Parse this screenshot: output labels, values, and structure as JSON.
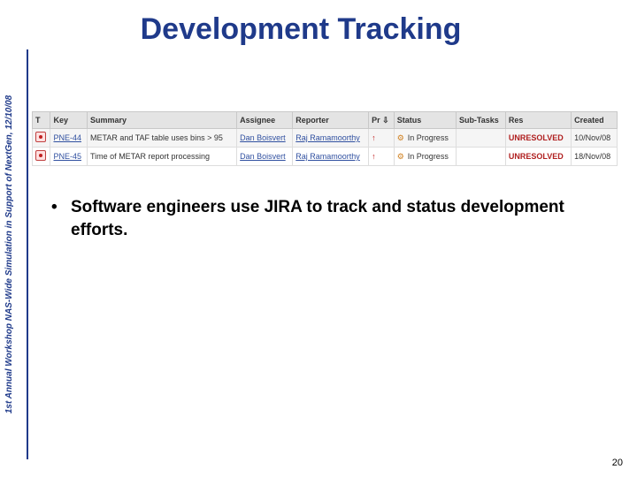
{
  "slide": {
    "title": "Development Tracking",
    "side_text": "1st Annual Workshop NAS-Wide Simulation in Support of NextGen, 12/10/08",
    "bullet_text": "Software engineers use JIRA to track and status development efforts.",
    "bullet_symbol": "•",
    "page_number": "20"
  },
  "jira_table": {
    "headers": [
      "T",
      "Key",
      "Summary",
      "Assignee",
      "Reporter",
      "Pr",
      "Status",
      "Sub-Tasks",
      "Res",
      "Created"
    ],
    "rows": [
      {
        "key": "PNE-44",
        "summary": "METAR and TAF table uses bins > 95",
        "assignee": "Dan Boisvert",
        "reporter": "Raj Ramamoorthy",
        "status": "In Progress",
        "subtasks": "",
        "resolution": "UNRESOLVED",
        "created": "10/Nov/08"
      },
      {
        "key": "PNE-45",
        "summary": "Time of METAR report processing",
        "assignee": "Dan Boisvert",
        "reporter": "Raj Ramamoorthy",
        "status": "In Progress",
        "subtasks": "",
        "resolution": "UNRESOLVED",
        "created": "18/Nov/08"
      }
    ]
  },
  "colors": {
    "title": "#1f3a8a",
    "side_rule": "#1f3a8a",
    "link": "#3050a0",
    "unresolved": "#b02020"
  },
  "icons": {
    "type": "bug-icon",
    "priority": "priority-up-arrow-icon",
    "status": "in-progress-icon",
    "sort": "sort-down-arrow-icon"
  }
}
